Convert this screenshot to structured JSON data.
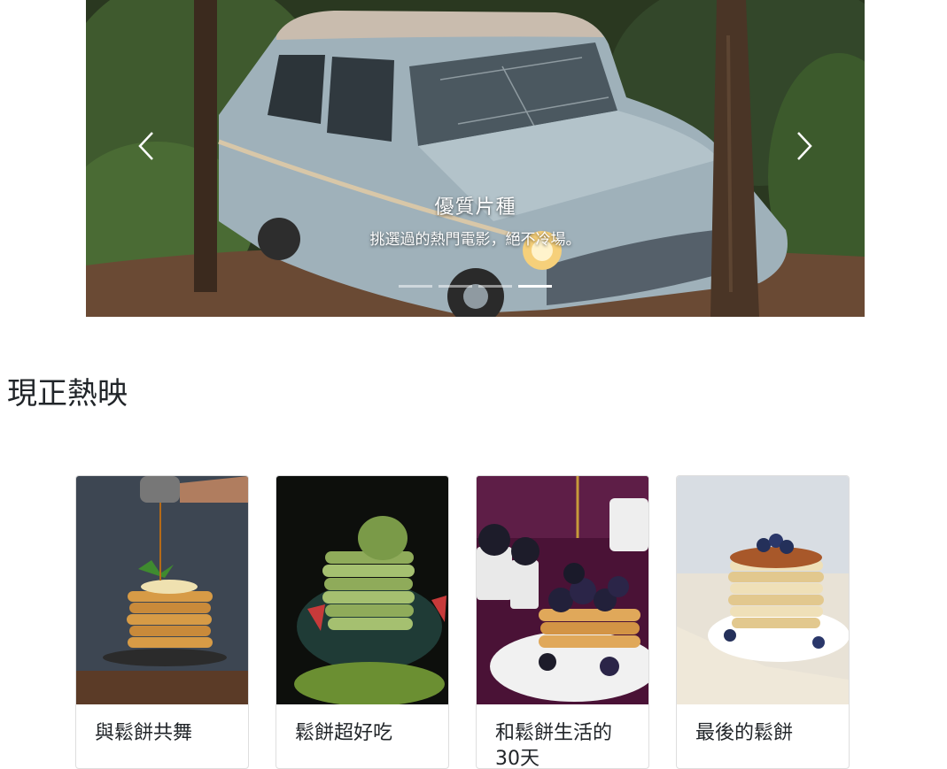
{
  "carousel": {
    "caption_title": "優質片種",
    "caption_text": "挑選過的熱門電影，絕不冷場。",
    "prev_icon": "chevron-left-icon",
    "next_icon": "chevron-right-icon",
    "slide_count": 4,
    "active_slide": 4
  },
  "section": {
    "title": "現正熱映"
  },
  "cards": [
    {
      "title": "與鬆餅共舞"
    },
    {
      "title": "鬆餅超好吃"
    },
    {
      "title": "和鬆餅生活的30天"
    },
    {
      "title": "最後的鬆餅"
    }
  ]
}
